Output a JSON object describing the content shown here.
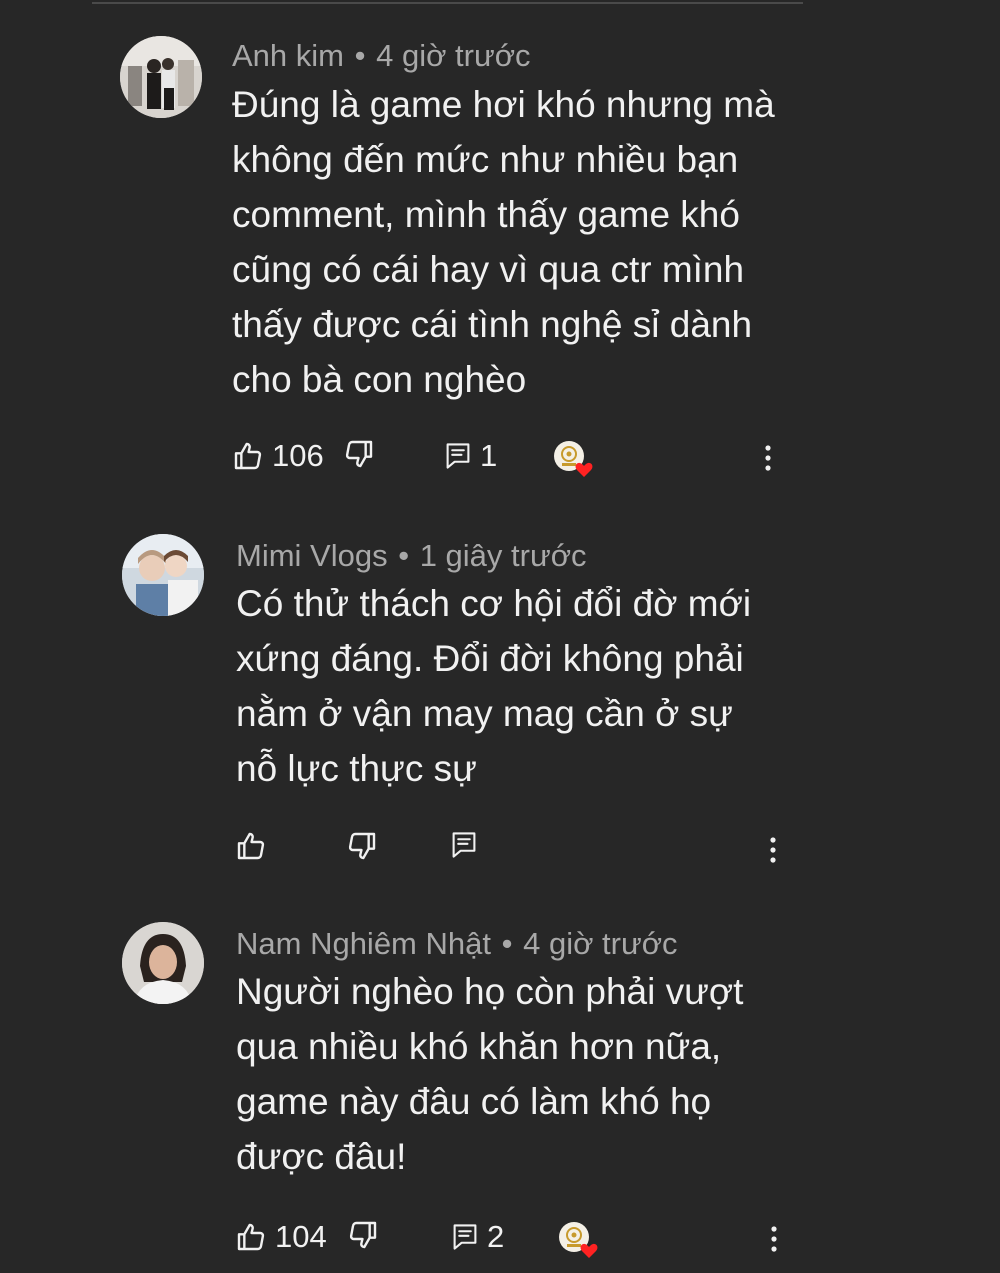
{
  "comments": [
    {
      "author": "Anh kim",
      "time": "4 giờ trước",
      "text": "Đúng là game hơi khó nhưng mà không đến mức như nhiều bạn comment, mình thấy game khó cũng có cái hay vì qua ctr mình thấy được cái tình nghệ sỉ  dành cho bà con nghèo",
      "likes": "106",
      "replies": "1",
      "creator_heart": true
    },
    {
      "author": "Mimi Vlogs",
      "time": "1 giây trước",
      "text": "Có thử thách cơ hội đổi đờ mới xứng đáng. Đổi đời không phải nằm ở vận may mag cần ở sự nỗ lực thực sự",
      "likes": "",
      "replies": "",
      "creator_heart": false
    },
    {
      "author": "Nam Nghiêm Nhật",
      "time": "4 giờ trước",
      "text": "Người nghèo họ còn phải vượt qua nhiều khó khăn hơn nữa, game này đâu có làm khó họ được đâu!",
      "likes": "104",
      "replies": "2",
      "creator_heart": true
    }
  ],
  "separator": "•",
  "icons": {
    "like": "thumbs-up-icon",
    "dislike": "thumbs-down-icon",
    "reply": "reply-icon",
    "more": "more-vert-icon",
    "heart": "creator-heart-icon"
  },
  "colors": {
    "background": "#272727",
    "text": "#f1f1f1",
    "meta": "#a8a8a8",
    "heart": "#ff2222"
  }
}
